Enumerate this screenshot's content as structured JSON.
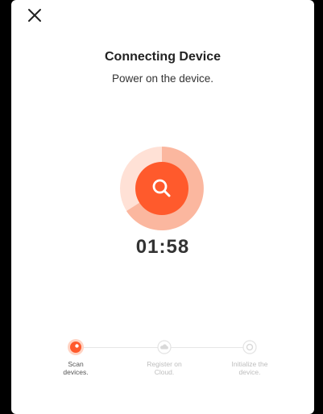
{
  "header": {
    "close_icon": "close-icon"
  },
  "main": {
    "title": "Connecting Device",
    "subtitle": "Power on the device.",
    "timer": "01:58",
    "scan_icon": "search-icon",
    "accent_color": "#ff5a2c"
  },
  "steps": [
    {
      "label": "Scan\ndevices.",
      "state": "active",
      "icon": "scan-icon"
    },
    {
      "label": "Register on\nCloud.",
      "state": "inactive",
      "icon": "cloud-icon"
    },
    {
      "label": "Initialize the\ndevice.",
      "state": "inactive",
      "icon": "device-icon"
    }
  ]
}
